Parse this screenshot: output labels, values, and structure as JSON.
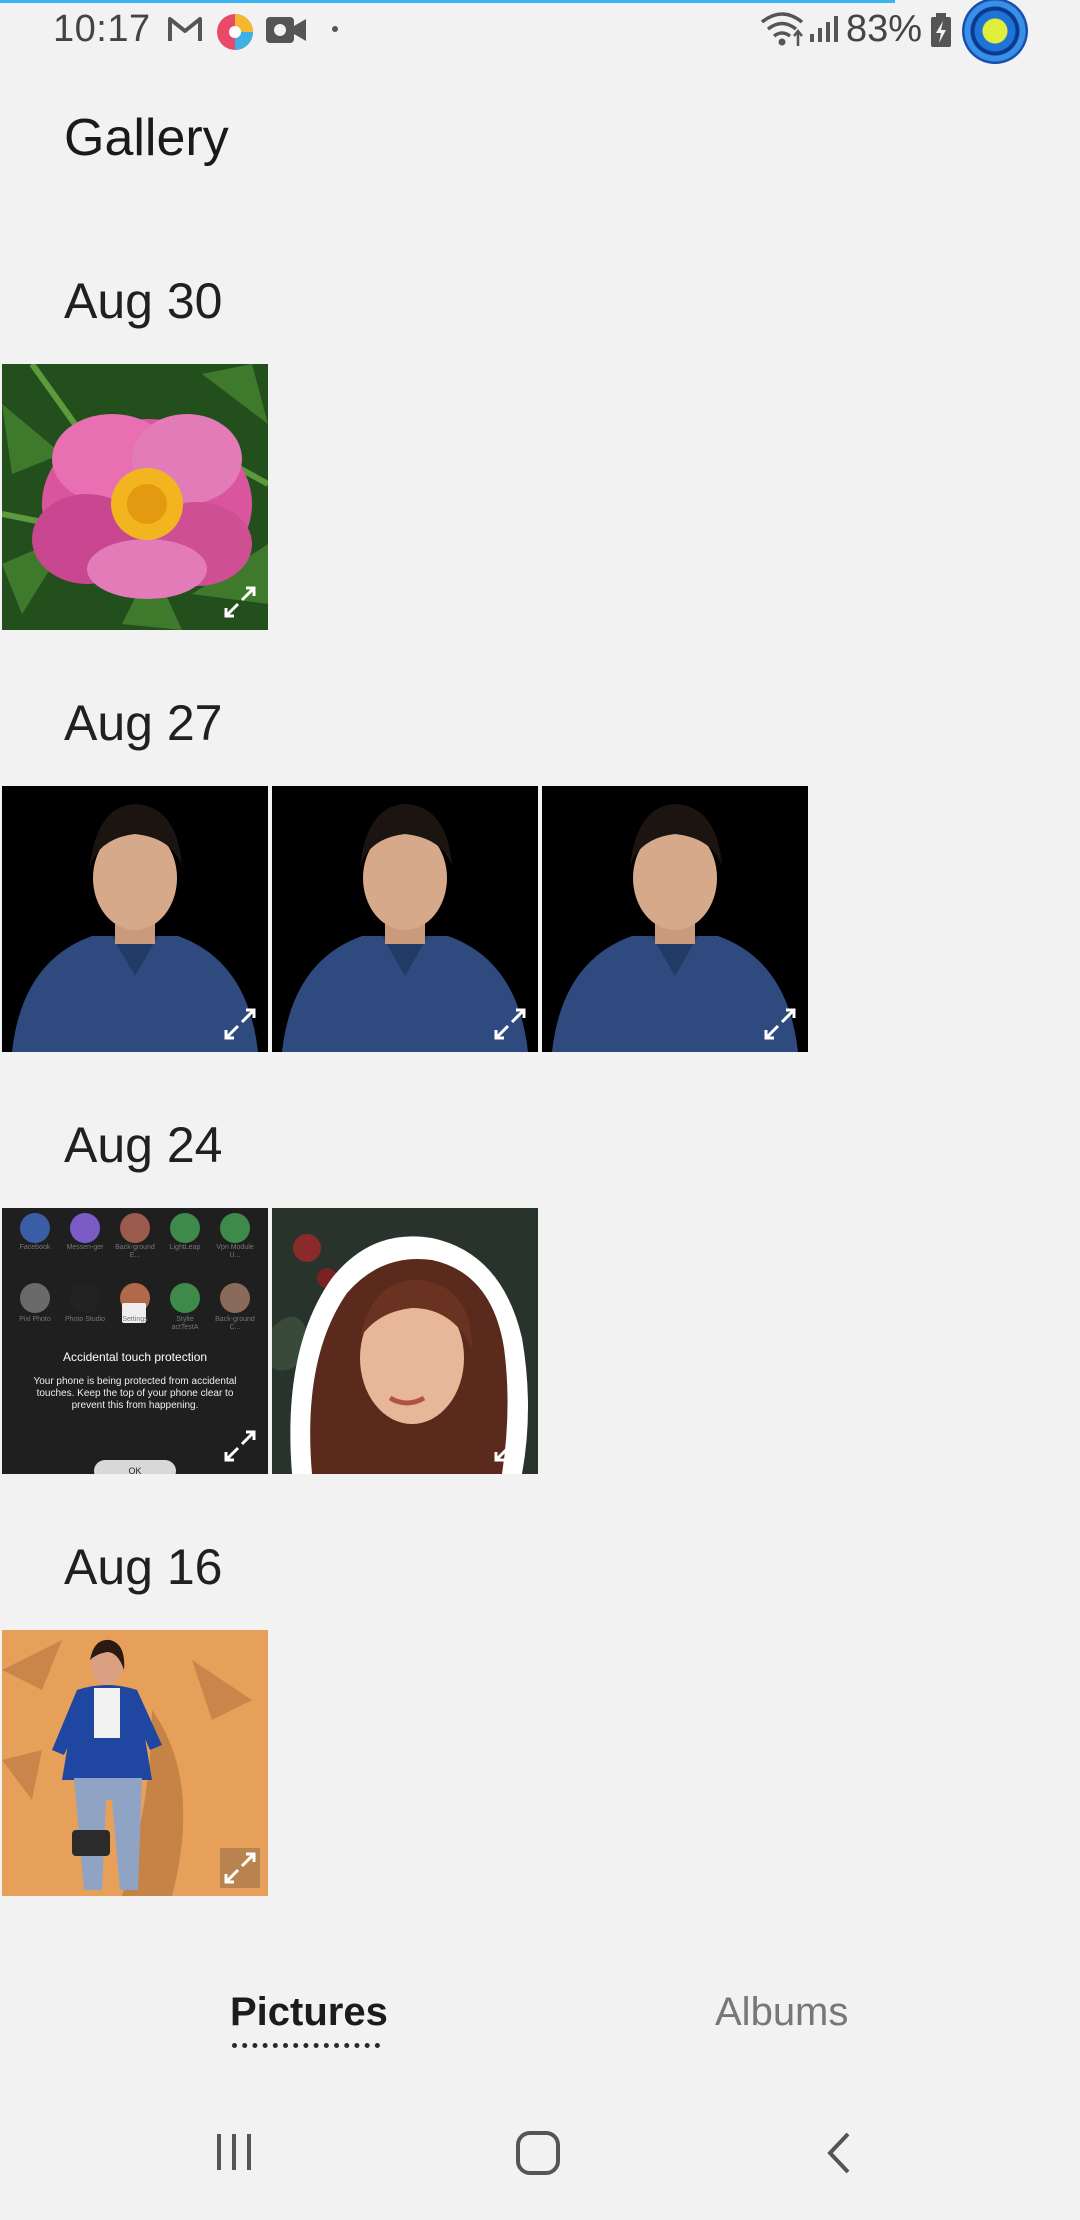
{
  "status_bar": {
    "time": "10:17",
    "battery": "83%",
    "notification_icons": [
      "gmail-icon",
      "photo-editor-icon",
      "video-camera-icon",
      "more-dot-icon"
    ],
    "system_icons": [
      "wifi-icon",
      "signal-icon",
      "battery-charging-icon",
      "assistant-bubble-icon"
    ]
  },
  "header": {
    "title": "Gallery"
  },
  "sections": [
    {
      "date": "Aug 30",
      "items": [
        "flower-photo"
      ]
    },
    {
      "date": "Aug 27",
      "items": [
        "portrait-photo",
        "portrait-photo",
        "portrait-photo"
      ]
    },
    {
      "date": "Aug 24",
      "items": [
        "screenshot",
        "sticker-portrait"
      ]
    },
    {
      "date": "Aug 16",
      "items": [
        "fashion-photo"
      ]
    }
  ],
  "screenshot_thumb": {
    "apps_row1": [
      "Facebook",
      "Messen-ger",
      "Back-ground E...",
      "LightLeap",
      "Vpn Module U..."
    ],
    "apps_row2": [
      "Pixl Photo",
      "Photo Studio",
      "Settings",
      "Stylte actTestA",
      "Back-ground C..."
    ],
    "dialog_title": "Accidental touch protection",
    "dialog_body": "Your phone is being protected from accidental touches. Keep the top of your phone clear to prevent this from happening.",
    "dialog_button": "OK"
  },
  "tabs": {
    "pictures": "Pictures",
    "albums": "Albums",
    "active": "Pictures"
  },
  "nav": [
    "recents-icon",
    "home-icon",
    "back-icon"
  ],
  "colors": {
    "background": "#f2f2f2",
    "accent_line": "#3ab4f2"
  }
}
